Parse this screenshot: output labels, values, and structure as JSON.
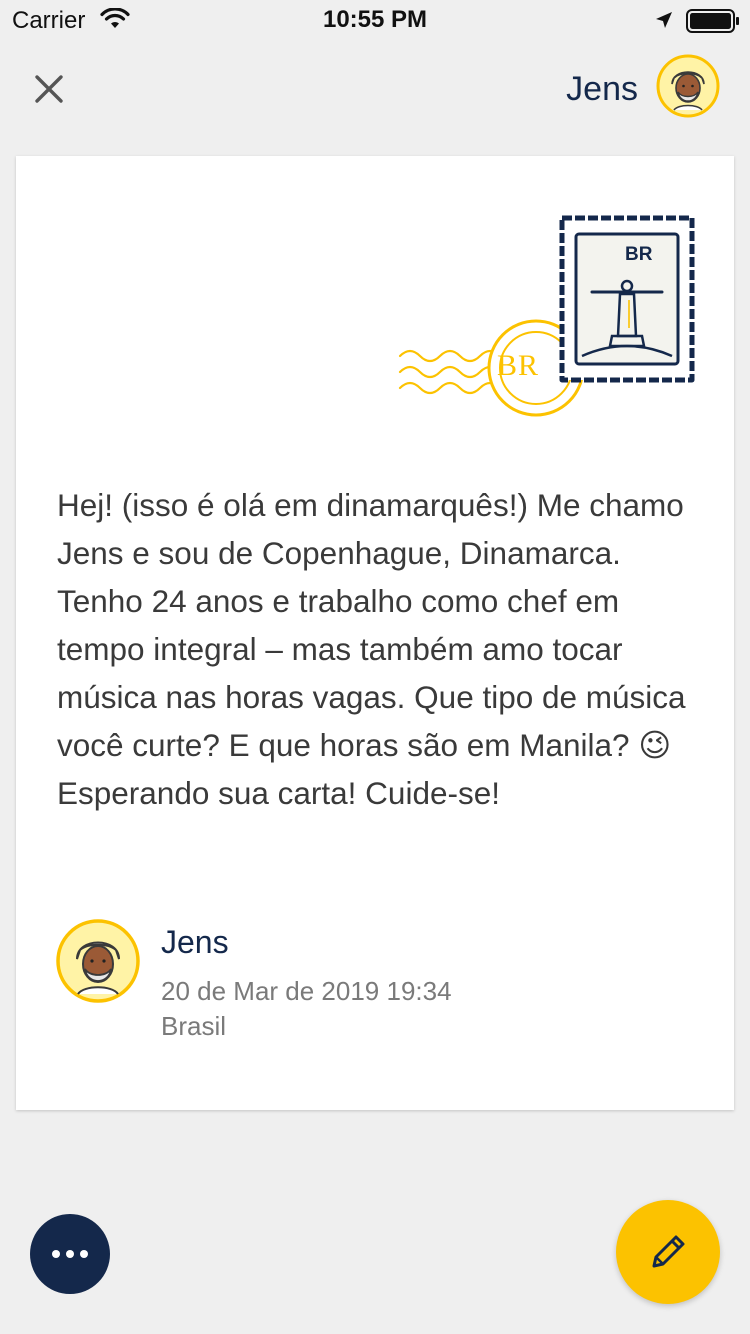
{
  "status_bar": {
    "carrier": "Carrier",
    "time": "10:55 PM"
  },
  "header": {
    "close_icon": "close-icon",
    "name": "Jens"
  },
  "stamp": {
    "country_code": "BR",
    "postmark_code": "BR"
  },
  "letter": {
    "body": "Hej! (isso é olá em dinamarquês!) Me chamo Jens e sou de Copenhague, Dinamarca. Tenho 24 anos e trabalho como chef em tempo integral – mas também amo tocar música nas horas vagas. Que tipo de música você curte? E que horas são em Manila? 😉 Esperando sua carta! Cuide-se!"
  },
  "author": {
    "name": "Jens",
    "date": "20 de Mar de 2019 19:34",
    "country": "Brasil"
  },
  "actions": {
    "more_icon": "more-icon",
    "compose_icon": "pencil-icon"
  },
  "colors": {
    "navy": "#14284b",
    "yellow": "#fcc200",
    "background": "#efefef"
  }
}
